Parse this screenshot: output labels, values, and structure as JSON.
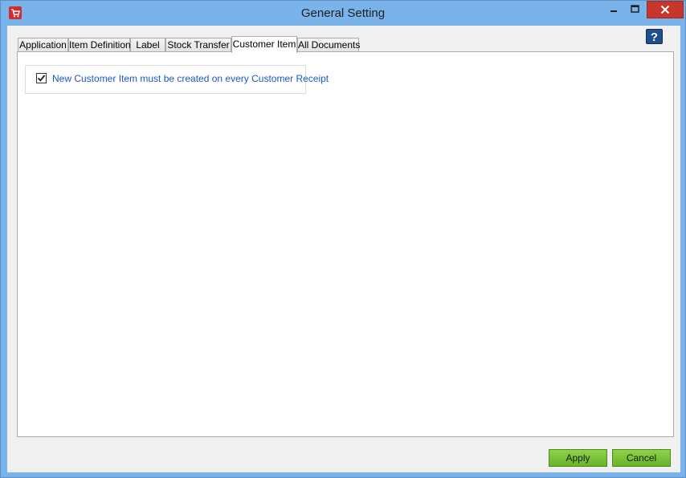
{
  "window": {
    "title": "General Setting",
    "icon": "cart-icon",
    "accent_color": "#79b3ea",
    "close_color": "#c7352b"
  },
  "help": {
    "label": "?"
  },
  "tabs": [
    {
      "label": "Application",
      "active": false
    },
    {
      "label": "Item Definition",
      "active": false
    },
    {
      "label": "Label",
      "active": false
    },
    {
      "label": "Stock Transfer",
      "active": false
    },
    {
      "label": "Customer Item",
      "active": true
    },
    {
      "label": "All Documents",
      "active": false
    }
  ],
  "customer_item": {
    "option_label": "New Customer Item must be created on every Customer Receipt",
    "option_checked": true
  },
  "footer": {
    "apply_label": "Apply",
    "cancel_label": "Cancel",
    "button_color": "#7cc23a"
  }
}
